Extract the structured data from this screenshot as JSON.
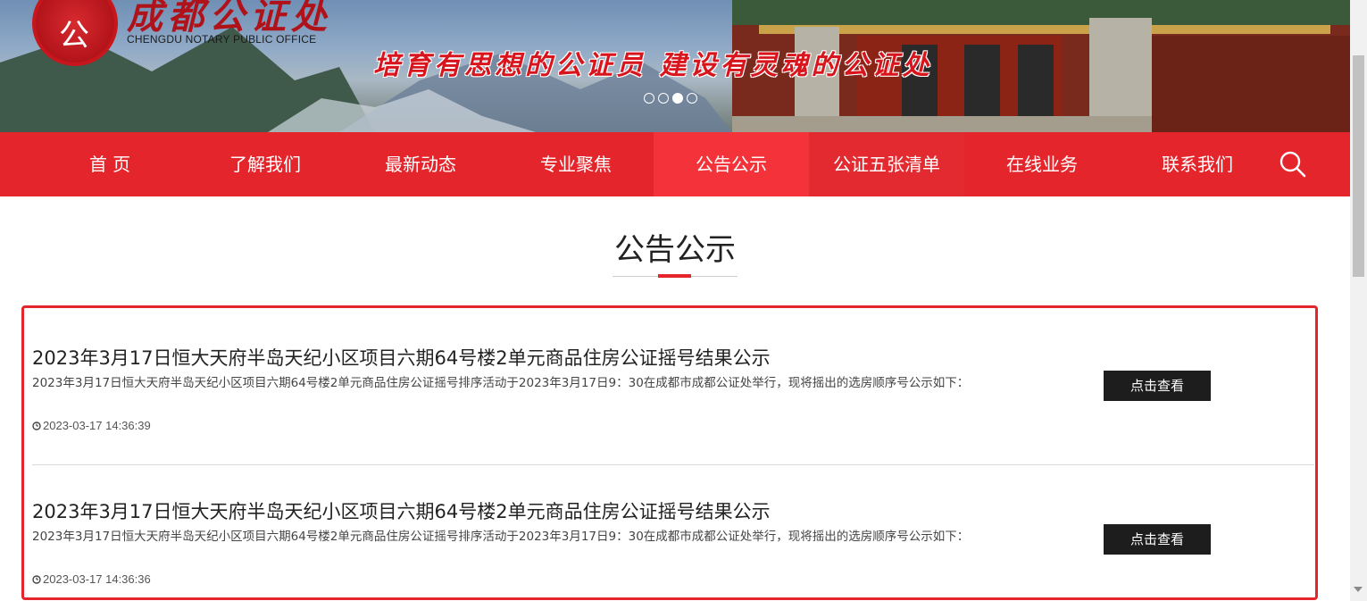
{
  "header": {
    "logo_seal_char": "公",
    "logo_cn": "成都公证处",
    "logo_en": "CHENGDU NOTARY PUBLIC OFFICE",
    "slogan": "培育有思想的公证员  建设有灵魂的公证处",
    "carousel": {
      "count": 4,
      "active_index": 2
    }
  },
  "nav": {
    "items": [
      {
        "label": "首 页"
      },
      {
        "label": "了解我们"
      },
      {
        "label": "最新动态"
      },
      {
        "label": "专业聚焦"
      },
      {
        "label": "公告公示"
      },
      {
        "label": "公证五张清单"
      },
      {
        "label": "在线业务"
      },
      {
        "label": "联系我们"
      }
    ],
    "active": "公告公示",
    "search_icon": "search-icon"
  },
  "section": {
    "title": "公告公示"
  },
  "announcements": [
    {
      "title": "2023年3月17日恒大天府半岛天纪小区项目六期64号楼2单元商品住房公证摇号结果公示",
      "desc": "2023年3月17日恒大天府半岛天纪小区项目六期64号楼2单元商品住房公证摇号排序活动于2023年3月17日9：30在成都市成都公证处举行，现将摇出的选房顺序号公示如下：",
      "time": "2023-03-17 14:36:39",
      "button": "点击查看"
    },
    {
      "title": "2023年3月17日恒大天府半岛天纪小区项目六期64号楼2单元商品住房公证摇号结果公示",
      "desc": "2023年3月17日恒大天府半岛天纪小区项目六期64号楼2单元商品住房公证摇号排序活动于2023年3月17日9：30在成都市成都公证处举行，现将摇出的选房顺序号公示如下：",
      "time": "2023-03-17 14:36:36",
      "button": "点击查看"
    }
  ],
  "colors": {
    "brand_red": "#e4262c",
    "nav_active": "#f33339",
    "button_dark": "#1d1d1d"
  }
}
